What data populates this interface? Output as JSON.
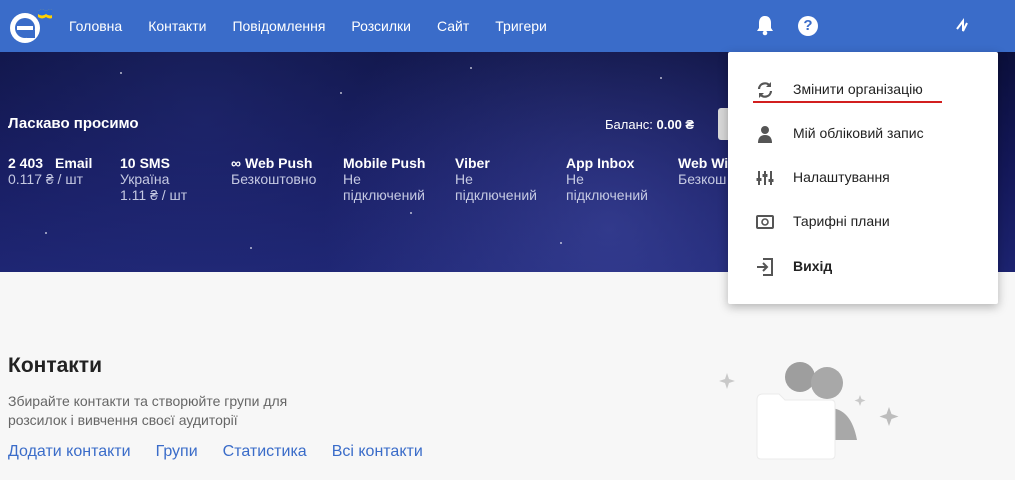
{
  "colors": {
    "brand": "#3a6cc9",
    "hero": "#14185a",
    "link": "#3a6cc9",
    "active_underline": "#d21f1f"
  },
  "nav": {
    "logo_icon": "esputnik-logo-icon",
    "items": [
      {
        "label": "Головна"
      },
      {
        "label": "Контакти"
      },
      {
        "label": "Повідомлення"
      },
      {
        "label": "Розсилки"
      },
      {
        "label": "Сайт"
      },
      {
        "label": "Тригери"
      }
    ],
    "help_glyph": "?"
  },
  "hero": {
    "welcome": "Ласкаво просимо",
    "balance_label": "Баланс:",
    "balance_value": "0.00 ₴",
    "stats": [
      {
        "qty": "2 403",
        "title": "Email",
        "sub1": "0.117 ₴ / шт",
        "sub2": ""
      },
      {
        "qty": "10",
        "title": "SMS",
        "sub1": "Україна",
        "sub2": "1.11 ₴ / шт"
      },
      {
        "qty": "∞",
        "title": "Web Push",
        "sub1": "Безкоштовно",
        "sub2": ""
      },
      {
        "qty": "",
        "title": "Mobile Push",
        "sub1": "Не",
        "sub2": "підключений"
      },
      {
        "qty": "",
        "title": "Viber",
        "sub1": "Не",
        "sub2": "підключений"
      },
      {
        "qty": "",
        "title": "App Inbox",
        "sub1": "Не",
        "sub2": "підключений"
      },
      {
        "qty": "",
        "title": "Web Wic",
        "sub1": "Безкош",
        "sub2": ""
      }
    ]
  },
  "content": {
    "title": "Контакти",
    "description": "Збирайте контакти та створюйте групи для розсилок і вивчення своєї аудиторії",
    "links": [
      {
        "label": "Додати контакти"
      },
      {
        "label": "Групи"
      },
      {
        "label": "Статистика"
      },
      {
        "label": "Всі контакти"
      }
    ]
  },
  "menu": {
    "items": [
      {
        "label": "Змінити організацію",
        "icon": "sync-icon"
      },
      {
        "label": "Мій обліковий запис",
        "icon": "user-icon"
      },
      {
        "label": "Налаштування",
        "icon": "sliders-icon"
      },
      {
        "label": "Тарифні плани",
        "icon": "money-icon"
      },
      {
        "label": "Вихід",
        "icon": "logout-icon"
      }
    ]
  }
}
